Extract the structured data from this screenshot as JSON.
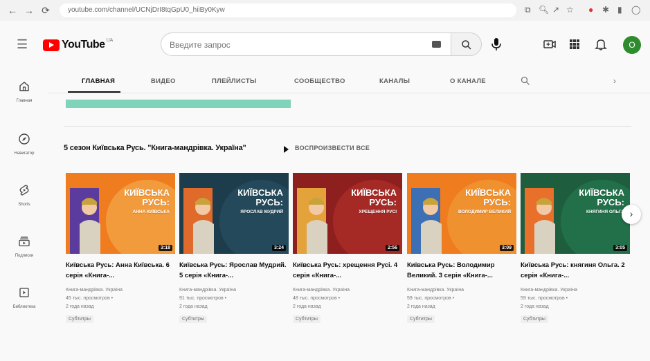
{
  "browser": {
    "url": "youtube.com/channel/UCNjDrI8tqGpU0_hiiBy0Kyw",
    "back": "←",
    "forward": "→",
    "reload": "⟳"
  },
  "header": {
    "logo_text": "YouTube",
    "logo_sup": "UA",
    "search_placeholder": "Введите запрос",
    "avatar_letter": "O",
    "menu_glyph": "☰"
  },
  "sidebar": {
    "items": [
      {
        "label": "Главная",
        "icon": "home-icon"
      },
      {
        "label": "Навигатор",
        "icon": "compass-icon"
      },
      {
        "label": "Shorts",
        "icon": "shorts-icon"
      },
      {
        "label": "Подписки",
        "icon": "subscriptions-icon"
      },
      {
        "label": "Библиотека",
        "icon": "library-icon"
      }
    ]
  },
  "tabs": [
    "ГЛАВНАЯ",
    "ВИДЕО",
    "ПЛЕЙЛИСТЫ",
    "СООБЩЕСТВО",
    "КАНАЛЫ",
    "О КАНАЛЕ"
  ],
  "tab_next": "›",
  "shelf": {
    "title": "5 сезон Київська Русь. \"Книга-мандрівка. Україна\"",
    "play_all": "ВОСПРОИЗВЕСТИ ВСЕ",
    "next_glyph": "›",
    "videos": [
      {
        "thumb_title": "КИЇВСЬКА РУСЬ:",
        "thumb_sub": "АННА КИЇВСЬКА",
        "duration": "3:18",
        "title": "Київська Русь: Анна Київська. 6 серія «Книга-...",
        "channel": "Книга-мандрівка. Україна",
        "views": "45 тыс. просмотров •",
        "age": "2 года назад",
        "badge": "Субтитры",
        "bg": "#ef7d1f",
        "left": "#5b3b9e",
        "circle": "#f29b3d"
      },
      {
        "thumb_title": "КИЇВСЬКА РУСЬ:",
        "thumb_sub": "ЯРОСЛАВ МУДРИЙ",
        "duration": "3:24",
        "title": "Київська Русь: Ярослав Мудрий. 5 серія «Книга-...",
        "channel": "Книга-мандрівка. Україна",
        "views": "91 тыс. просмотров •",
        "age": "2 года назад",
        "badge": "Субтитры",
        "bg": "#1e3d4c",
        "left": "#e06a2a",
        "circle": "#23495a"
      },
      {
        "thumb_title": "КИЇВСЬКА РУСЬ:",
        "thumb_sub": "ХРЕЩЕННЯ РУСІ",
        "duration": "2:56",
        "title": "Київська Русь: хрещення Русі. 4 серія «Книга-...",
        "channel": "Книга-мандрівка. Україна",
        "views": "48 тыс. просмотров •",
        "age": "2 года назад",
        "badge": "Субтитры",
        "bg": "#8e1f1f",
        "left": "#e4a23a",
        "circle": "#a52a25"
      },
      {
        "thumb_title": "КИЇВСЬКА РУСЬ:",
        "thumb_sub": "ВОЛОДИМИР ВЕЛИКИЙ",
        "duration": "3:09",
        "title": "Київська Русь: Володимир Великий. 3 серія «Книга-...",
        "channel": "Книга-мандрівка. Україна",
        "views": "59 тыс. просмотров •",
        "age": "2 года назад",
        "badge": "Субтитры",
        "bg": "#ef7d1f",
        "left": "#3d6fb5",
        "circle": "#f0912f"
      },
      {
        "thumb_title": "КИЇВСЬКА РУСЬ:",
        "thumb_sub": "КНЯГИНЯ ОЛЬГА",
        "duration": "3:05",
        "title": "Київська Русь: княгиня Ольга. 2 серія «Книга-...",
        "channel": "Книга-мандрівка. Україна",
        "views": "59 тыс. просмотров •",
        "age": "2 года назад",
        "badge": "Субтитры",
        "bg": "#1e5e3e",
        "left": "#e8702a",
        "circle": "#22704a"
      }
    ]
  }
}
